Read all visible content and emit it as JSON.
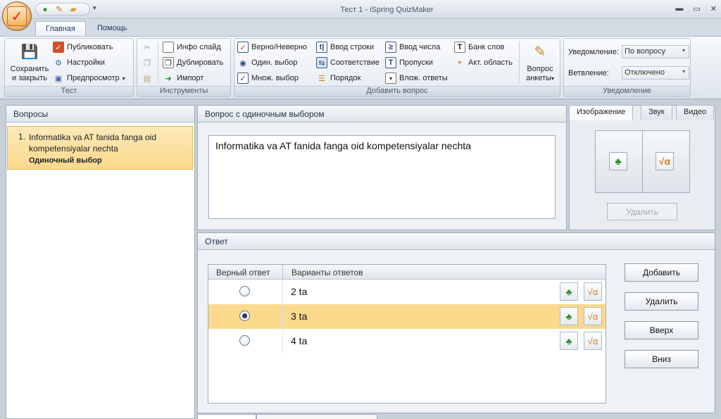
{
  "window": {
    "title": "Тест 1 - iSpring QuizMaker",
    "controls": [
      "minimize",
      "maximize",
      "close"
    ]
  },
  "ribbon": {
    "tabs": [
      {
        "label": "Главная",
        "active": true
      },
      {
        "label": "Помощь",
        "active": false
      }
    ],
    "groups": {
      "test": {
        "label": "Тест",
        "save_close_line1": "Сохранить",
        "save_close_line2": "и закрыть",
        "publish": "Публиковать",
        "settings": "Настройки",
        "preview": "Предпросмотр"
      },
      "tools": {
        "label": "Инструменты",
        "info_slide": "Инфо слайд",
        "duplicate": "Дублировать",
        "import": "Импорт"
      },
      "add_question": {
        "label": "Добавить вопрос",
        "true_false": "Верно/Неверно",
        "single_choice": "Один. выбор",
        "multiple_choice": "Множ. выбор",
        "type_in": "Ввод строки",
        "matching": "Соответствие",
        "sequence": "Порядок",
        "numeric": "Ввод числа",
        "fill_blanks": "Пропуски",
        "multiple_response": "Влож. ответы",
        "word_bank": "Банк слов",
        "hotspot": "Акт. область",
        "survey_line1": "Вопрос",
        "survey_line2": "анкеты"
      },
      "notification": {
        "label": "Уведомление",
        "notify_label": "Уведомление:",
        "notify_value": "По вопросу",
        "branching_label": "Ветвление:",
        "branching_value": "Отключено"
      }
    }
  },
  "questions_panel": {
    "title": "Вопросы",
    "items": [
      {
        "number": "1.",
        "text": "Informatika va AT fanida fanga oid kompetensiyalar nechta",
        "type": "Одиночный выбор",
        "selected": true
      }
    ]
  },
  "question_panel": {
    "title": "Вопрос с одиночным выбором",
    "text": "Informatika va AT fanida fanga oid kompetensiyalar nechta"
  },
  "media_panel": {
    "tabs": [
      "Изображение",
      "Звук",
      "Видео"
    ],
    "active_tab": "Изображение",
    "delete_label": "Удалить"
  },
  "answer_panel": {
    "title": "Ответ",
    "columns": [
      "Верный ответ",
      "Варианты ответов"
    ],
    "rows": [
      {
        "text": "2 ta",
        "correct": false
      },
      {
        "text": "3 ta",
        "correct": true
      },
      {
        "text": "4 ta",
        "correct": false
      }
    ],
    "buttons": {
      "add": "Добавить",
      "delete": "Удалить",
      "up": "Вверх",
      "down": "Вниз"
    }
  },
  "colors": {
    "selection": "#fbd98d",
    "panel_border": "#9eacbc",
    "ribbon_bg": "#dde4ec"
  }
}
